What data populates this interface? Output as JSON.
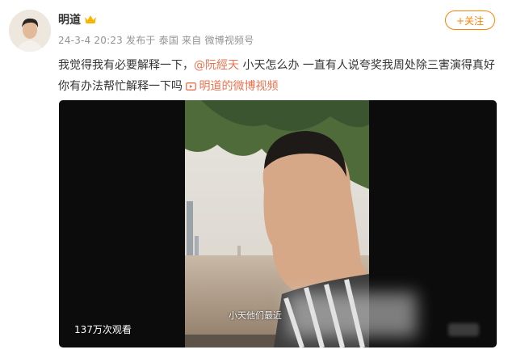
{
  "post": {
    "author_name": "明道",
    "meta": "24-3-4 20:23  发布于 泰国  来自 微博视频号",
    "follow_label": "+关注",
    "text_before": "我觉得我有必要解释一下，",
    "mention": "@阮經天",
    "text_after": " 小天怎么办 一直有人说夸奖我周处除三害演得真好 你有办法帮忙解释一下吗 ",
    "video_link_label": "明道的微博视频",
    "video": {
      "views": "137万次观看",
      "subtitle": "小天他们最近"
    }
  },
  "colors": {
    "accent": "#ff8200",
    "link": "#eb7350",
    "meta": "#939393"
  },
  "icons": [
    "crown-icon",
    "video-link-icon"
  ]
}
